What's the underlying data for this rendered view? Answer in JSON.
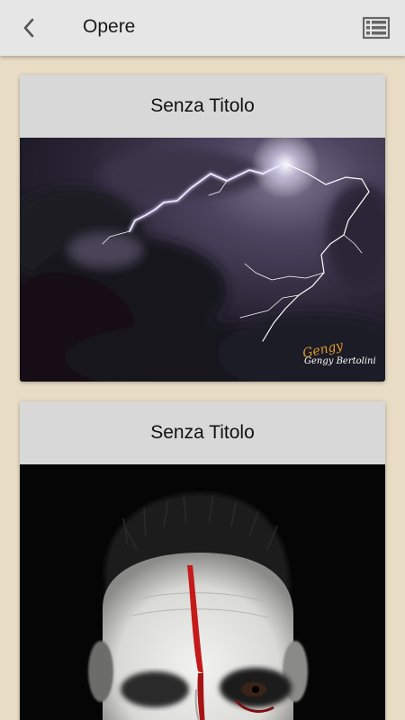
{
  "appbar": {
    "title": "Opere",
    "back_icon": "chevron-left-icon",
    "menu_icon": "list-view-icon"
  },
  "cards": [
    {
      "title": "Senza Titolo",
      "image_desc_icon": "lightning-storm-photo",
      "signature": "Gengy Bertolini"
    },
    {
      "title": "Senza Titolo",
      "image_desc_icon": "clown-face-portrait-photo"
    }
  ],
  "colors": {
    "background": "#e8dcc4",
    "appbar": "#e6e6e6",
    "card_header": "#d8d8d8"
  }
}
